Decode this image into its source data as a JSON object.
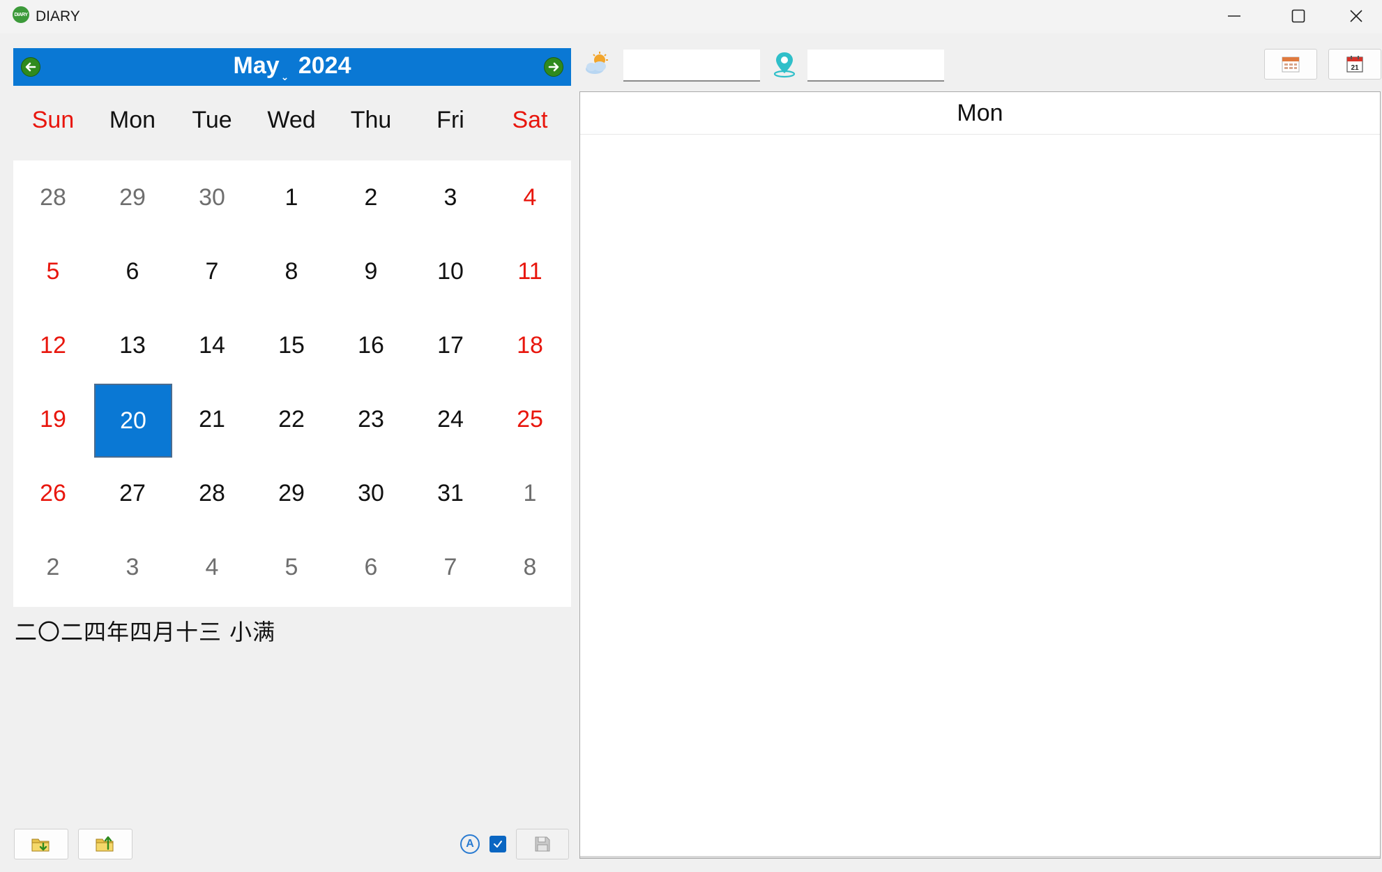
{
  "window": {
    "app_icon_text": "DIARY",
    "title": "DIARY"
  },
  "calendar": {
    "month": "May",
    "year": "2024",
    "dropdown_glyph": "⌄",
    "weekdays": [
      "Sun",
      "Mon",
      "Tue",
      "Wed",
      "Thu",
      "Fri",
      "Sat"
    ],
    "weeks": [
      [
        "28",
        "29",
        "30",
        "1",
        "2",
        "3",
        "4"
      ],
      [
        "5",
        "6",
        "7",
        "8",
        "9",
        "10",
        "11"
      ],
      [
        "12",
        "13",
        "14",
        "15",
        "16",
        "17",
        "18"
      ],
      [
        "19",
        "20",
        "21",
        "22",
        "23",
        "24",
        "25"
      ],
      [
        "26",
        "27",
        "28",
        "29",
        "30",
        "31",
        "1"
      ],
      [
        "2",
        "3",
        "4",
        "5",
        "6",
        "7",
        "8"
      ]
    ],
    "selected_day": "20",
    "lunar_date": "二〇二四年四月十三 小满"
  },
  "toolbar": {
    "weather_value": "",
    "location_value": "",
    "spellcheck_glyph": "A"
  },
  "editor": {
    "weekday_header": "Mon",
    "content": ""
  },
  "colors": {
    "accent": "#0a78d4",
    "weekend": "#e8160d",
    "other_month": "#6e6e6e",
    "nav_green": "#2f8a1e"
  }
}
